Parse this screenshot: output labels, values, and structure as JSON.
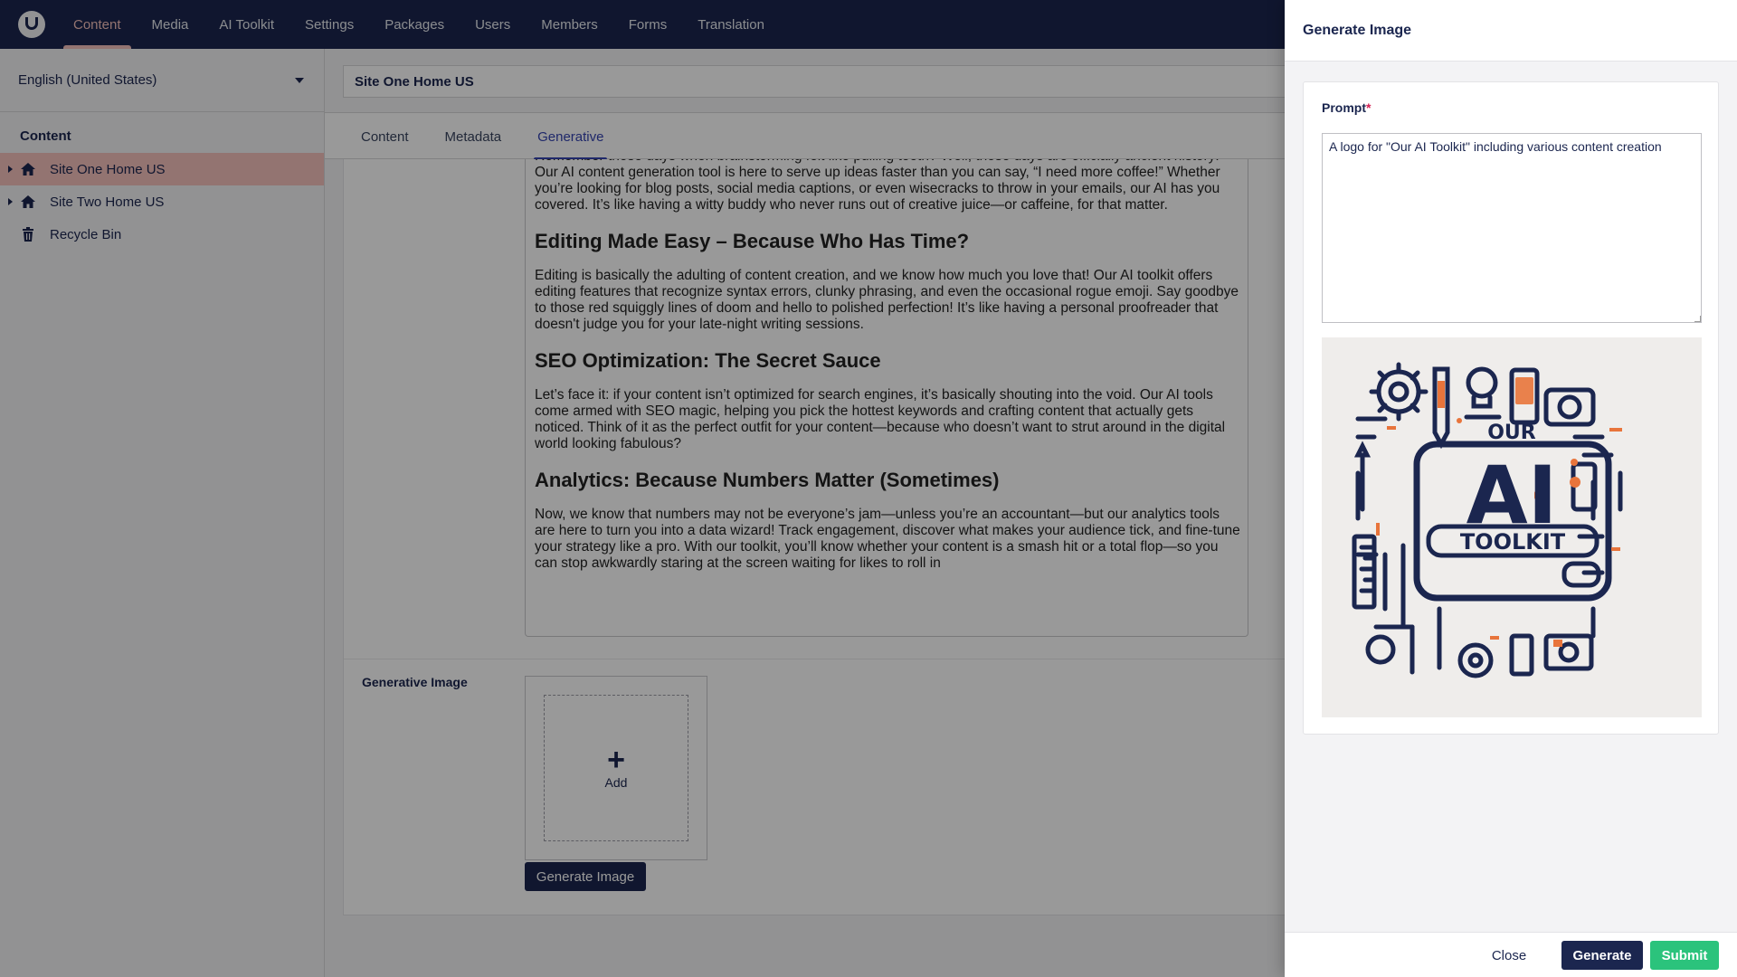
{
  "topnav": {
    "items": [
      {
        "label": "Content"
      },
      {
        "label": "Media"
      },
      {
        "label": "AI Toolkit"
      },
      {
        "label": "Settings"
      },
      {
        "label": "Packages"
      },
      {
        "label": "Users"
      },
      {
        "label": "Members"
      },
      {
        "label": "Forms"
      },
      {
        "label": "Translation"
      }
    ],
    "active": "Content"
  },
  "sidebar": {
    "language": "English (United States)",
    "section_title": "Content",
    "tree": [
      {
        "label": "Site One Home US",
        "icon": "home-icon",
        "active": true
      },
      {
        "label": "Site Two Home US",
        "icon": "home-icon",
        "active": false
      },
      {
        "label": "Recycle Bin",
        "icon": "trash-icon",
        "active": false
      }
    ]
  },
  "editor": {
    "node_name": "Site One Home US",
    "tabs": [
      {
        "label": "Content"
      },
      {
        "label": "Metadata"
      },
      {
        "label": "Generative"
      }
    ],
    "active_tab": "Generative",
    "rich_text": {
      "p1": "Remember those days when brainstorming felt like pulling teeth? Well, those days are officially ancient history! Our AI content generation tool is here to serve up ideas faster than you can say, “I need more coffee!” Whether you’re looking for blog posts, social media captions, or even wisecracks to throw in your emails, our AI has you covered. It’s like having a witty buddy who never runs out of creative juice—or caffeine, for that matter.",
      "h2": "Editing Made Easy – Because Who Has Time?",
      "p2": "Editing is basically the adulting of content creation, and we know how much you love that! Our AI toolkit offers editing features that recognize syntax errors, clunky phrasing, and even the occasional rogue emoji. Say goodbye to those red squiggly lines of doom and hello to polished perfection! It’s like having a personal proofreader that doesn't judge you for your late-night writing sessions.",
      "h3": "SEO Optimization: The Secret Sauce",
      "p3": "Let’s face it: if your content isn’t optimized for search engines, it’s basically shouting into the void. Our AI tools come armed with SEO magic, helping you pick the hottest keywords and crafting content that actually gets noticed. Think of it as the perfect outfit for your content—because who doesn’t want to strut around in the digital world looking fabulous?",
      "h4": "Analytics: Because Numbers Matter (Sometimes)",
      "p4": "Now, we know that numbers may not be everyone’s jam—unless you’re an accountant—but our analytics tools are here to turn you into a data wizard! Track engagement, discover what makes your audience tick, and fine-tune your strategy like a pro. With our toolkit, you’ll know whether your content is a smash hit or a total flop—so you can stop awkwardly staring at the screen waiting for likes to roll in"
    },
    "generative_image_label": "Generative Image",
    "add_label": "Add",
    "generate_image_button": "Generate Image"
  },
  "dialog": {
    "title": "Generate Image",
    "prompt_label": "Prompt",
    "required_mark": "*",
    "prompt_value": "A logo for \"Our AI Toolkit\" including various content creation",
    "image": {
      "top_text": "OUR",
      "main_text": "AI",
      "bottom_text": "TOOLKIT"
    },
    "buttons": {
      "close": "Close",
      "generate": "Generate",
      "submit": "Submit"
    }
  },
  "colors": {
    "header_bg": "#1b264f",
    "active_accent": "#f5c1bc",
    "tab_accent": "#3544b1",
    "submit_green": "#2bc37c",
    "logo_orange": "#e8743b"
  }
}
